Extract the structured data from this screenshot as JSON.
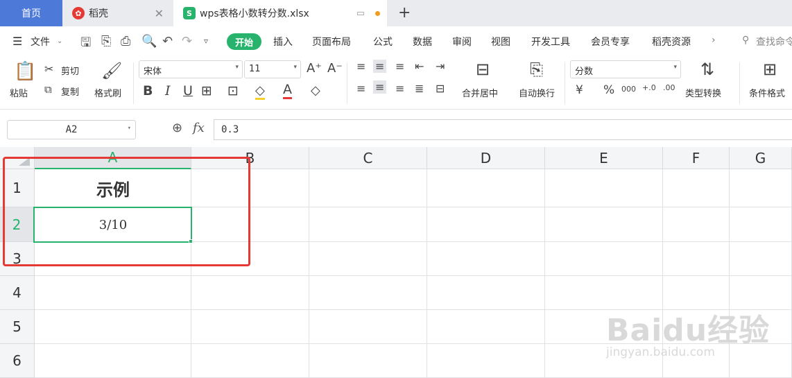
{
  "tabs": {
    "home": "首页",
    "doc": "稻壳",
    "active": "wps表格小数转分数.xlsx"
  },
  "menu": {
    "file": "文件",
    "start": "开始",
    "items": [
      "插入",
      "页面布局",
      "公式",
      "数据",
      "审阅",
      "视图",
      "开发工具",
      "会员专享",
      "稻壳资源"
    ],
    "search": "查找命令"
  },
  "ribbon": {
    "paste": "粘贴",
    "cut": "剪切",
    "copy": "复制",
    "format_painter": "格式刷",
    "font_name": "宋体",
    "font_size": "11",
    "merge_center": "合并居中",
    "wrap_text": "自动换行",
    "number_format": "分数",
    "type_convert": "类型转换",
    "conditional_format": "条件格式"
  },
  "formula_bar": {
    "name_box": "A2",
    "fx": "fx",
    "value": "0.3"
  },
  "columns": [
    "A",
    "B",
    "C",
    "D",
    "E",
    "F",
    "G"
  ],
  "rows": [
    "1",
    "2",
    "3",
    "4",
    "5",
    "6"
  ],
  "cells": {
    "A1": "示例",
    "A2": "3/10"
  },
  "watermark": {
    "brand": "Baidu经验",
    "url": "jingyan.baidu.com"
  },
  "colors": {
    "accent": "#27b36b",
    "home_tab": "#4d7ad9",
    "highlight_box": "#e53935"
  }
}
